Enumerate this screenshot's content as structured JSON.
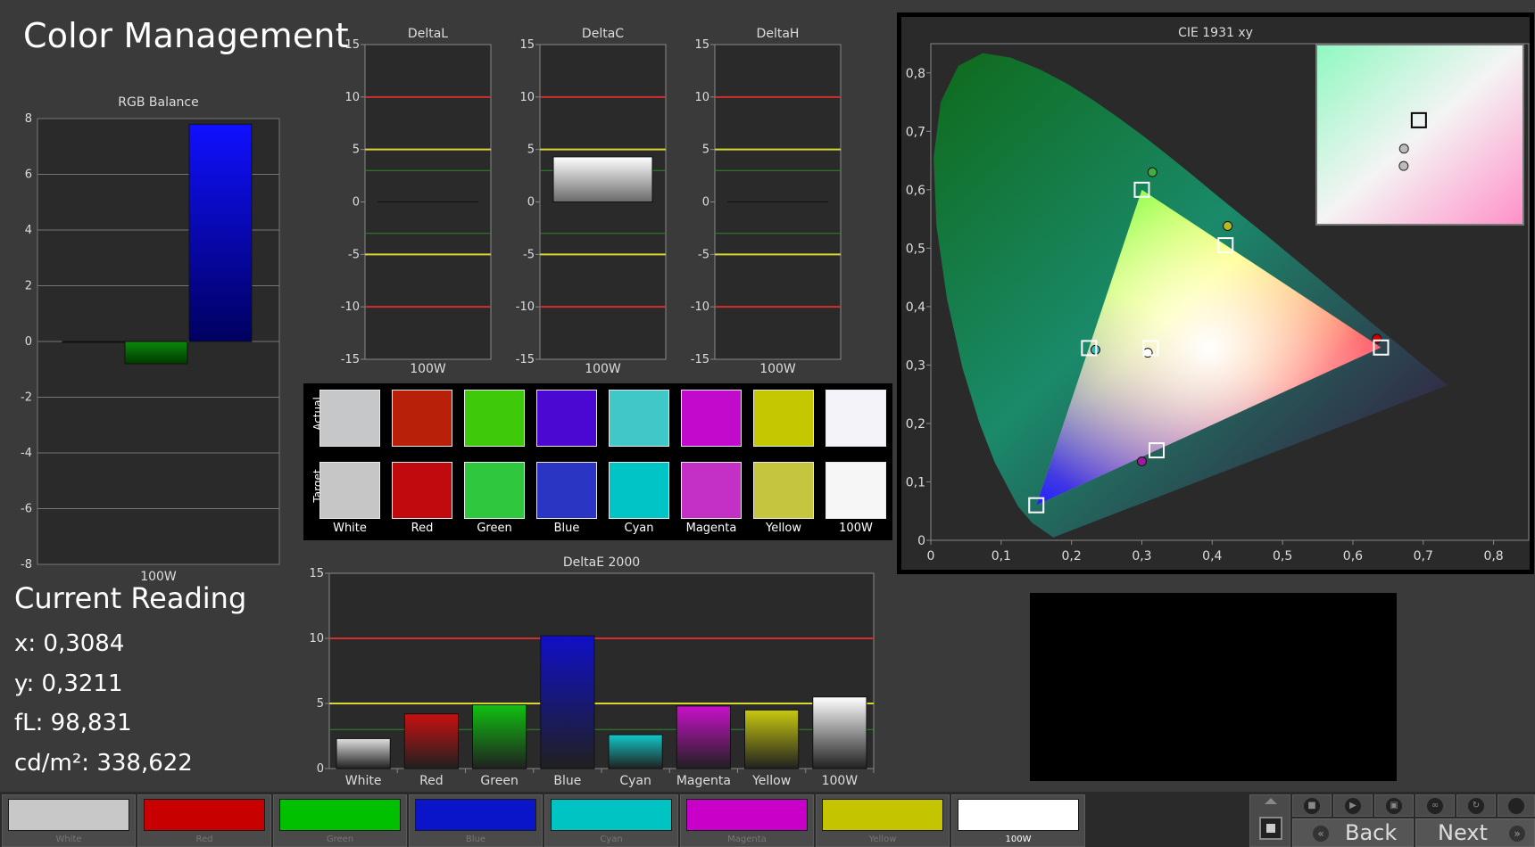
{
  "app": {
    "title": "Color Management"
  },
  "rgb_balance": {
    "title": "RGB Balance",
    "xlabel": "100W",
    "yticks": [
      "8",
      "6",
      "4",
      "2",
      "0",
      "-2",
      "-4",
      "-6",
      "-8"
    ]
  },
  "deltas": [
    {
      "title": "DeltaL",
      "xlabel": "100W"
    },
    {
      "title": "DeltaC",
      "xlabel": "100W"
    },
    {
      "title": "DeltaH",
      "xlabel": "100W"
    }
  ],
  "delta_yticks": [
    "15",
    "10",
    "5",
    "0",
    "-5",
    "-10",
    "-15"
  ],
  "swatches": {
    "row_actual": "Actual",
    "row_target": "Target",
    "items": [
      {
        "label": "White",
        "actual": "#c5c7c9",
        "target": "#c6c6c6"
      },
      {
        "label": "Red",
        "actual": "#b8200a",
        "target": "#c00a0e"
      },
      {
        "label": "Green",
        "actual": "#3ec90a",
        "target": "#2fc73e"
      },
      {
        "label": "Blue",
        "actual": "#4a08d2",
        "target": "#2a35c4"
      },
      {
        "label": "Cyan",
        "actual": "#40c8c8",
        "target": "#00c4c6"
      },
      {
        "label": "Magenta",
        "actual": "#c20acc",
        "target": "#c42fc5"
      },
      {
        "label": "Yellow",
        "actual": "#c5c800",
        "target": "#c6c63e"
      },
      {
        "label": "100W",
        "actual": "#f4f3fa",
        "target": "#f6f6f6"
      }
    ]
  },
  "deltae": {
    "title": "DeltaE 2000",
    "yticks": [
      "15",
      "10",
      "5",
      "0"
    ]
  },
  "cie": {
    "title": "CIE 1931 xy",
    "xticks": [
      "0",
      "0,1",
      "0,2",
      "0,3",
      "0,4",
      "0,5",
      "0,6",
      "0,7",
      "0,8"
    ],
    "yticks": [
      "0",
      "0,1",
      "0,2",
      "0,3",
      "0,4",
      "0,5",
      "0,6",
      "0,7",
      "0,8"
    ]
  },
  "current_reading": {
    "title": "Current Reading",
    "x": "x: 0,3084",
    "y": "y: 0,3211",
    "fl": "fL: 98,831",
    "cdm2": "cd/m²: 338,622"
  },
  "bottom_bar": {
    "patches": [
      {
        "label": "White",
        "color": "#c8c8c8"
      },
      {
        "label": "Red",
        "color": "#c80000"
      },
      {
        "label": "Green",
        "color": "#00c000"
      },
      {
        "label": "Blue",
        "color": "#0a14c8"
      },
      {
        "label": "Cyan",
        "color": "#00c4c4"
      },
      {
        "label": "Magenta",
        "color": "#c800c8"
      },
      {
        "label": "Yellow",
        "color": "#c4c400"
      },
      {
        "label": "100W",
        "color": "#ffffff"
      }
    ],
    "back_label": "Back",
    "next_label": "Next"
  },
  "chart_data": [
    {
      "type": "bar",
      "title": "RGB Balance",
      "categories": [
        "100W"
      ],
      "series": [
        {
          "values": [
            0
          ]
        },
        {
          "values": [
            -0.8
          ]
        },
        {
          "values": [
            7.8
          ]
        }
      ],
      "colors": [
        "#c80000",
        "#0a8a0a",
        "#1010ff"
      ],
      "ylim": [
        -8,
        8
      ],
      "grid": true
    },
    {
      "type": "bar",
      "title": "DeltaL",
      "categories": [
        "100W"
      ],
      "values": [
        0
      ],
      "ylim": [
        -15,
        15
      ],
      "reference_lines": [
        10,
        5,
        3,
        -3,
        -5,
        -10
      ]
    },
    {
      "type": "bar",
      "title": "DeltaC",
      "categories": [
        "100W"
      ],
      "values": [
        4.3
      ],
      "ylim": [
        -15,
        15
      ],
      "reference_lines": [
        10,
        5,
        3,
        -3,
        -5,
        -10
      ]
    },
    {
      "type": "bar",
      "title": "DeltaH",
      "categories": [
        "100W"
      ],
      "values": [
        0
      ],
      "ylim": [
        -15,
        15
      ],
      "reference_lines": [
        10,
        5,
        3,
        -3,
        -5,
        -10
      ]
    },
    {
      "type": "bar",
      "title": "DeltaE 2000",
      "categories": [
        "White",
        "Red",
        "Green",
        "Blue",
        "Cyan",
        "Magenta",
        "Yellow",
        "100W"
      ],
      "values": [
        2.3,
        4.2,
        4.9,
        10.2,
        2.6,
        4.8,
        4.5,
        5.5
      ],
      "colors": [
        "#e0e0e0",
        "#c81010",
        "#10c010",
        "#1010c8",
        "#10c8c8",
        "#c810c8",
        "#c8c810",
        "#ffffff"
      ],
      "ylim": [
        0,
        15
      ],
      "reference_lines": [
        10,
        5,
        3
      ]
    },
    {
      "type": "scatter",
      "title": "CIE 1931 xy",
      "xlim": [
        0,
        0.85
      ],
      "ylim": [
        0,
        0.85
      ],
      "targets": [
        {
          "name": "Red",
          "x": 0.64,
          "y": 0.33
        },
        {
          "name": "Green",
          "x": 0.3,
          "y": 0.6
        },
        {
          "name": "Blue",
          "x": 0.15,
          "y": 0.06
        },
        {
          "name": "Cyan",
          "x": 0.225,
          "y": 0.329
        },
        {
          "name": "Magenta",
          "x": 0.321,
          "y": 0.154
        },
        {
          "name": "Yellow",
          "x": 0.419,
          "y": 0.505
        },
        {
          "name": "White",
          "x": 0.3127,
          "y": 0.329
        }
      ],
      "measured": [
        {
          "name": "Red",
          "x": 0.634,
          "y": 0.345,
          "color": "#c80000"
        },
        {
          "name": "Green",
          "x": 0.315,
          "y": 0.63,
          "color": "#3fb03f"
        },
        {
          "name": "Cyan",
          "x": 0.234,
          "y": 0.326,
          "color": "#30b8b8"
        },
        {
          "name": "Magenta",
          "x": 0.3,
          "y": 0.135,
          "color": "#a01aa0"
        },
        {
          "name": "Yellow",
          "x": 0.422,
          "y": 0.538,
          "color": "#b8b820"
        },
        {
          "name": "White",
          "x": 0.3084,
          "y": 0.3211,
          "color": "#ffffff"
        }
      ],
      "inset": {
        "xlim": [
          0.283,
          0.343
        ],
        "ylim": [
          0.3,
          0.35
        ],
        "target": {
          "x": 0.3127,
          "y": 0.329
        },
        "measured": [
          {
            "x": 0.3084,
            "y": 0.3211
          },
          {
            "x": 0.3083,
            "y": 0.3163
          }
        ]
      }
    }
  ]
}
